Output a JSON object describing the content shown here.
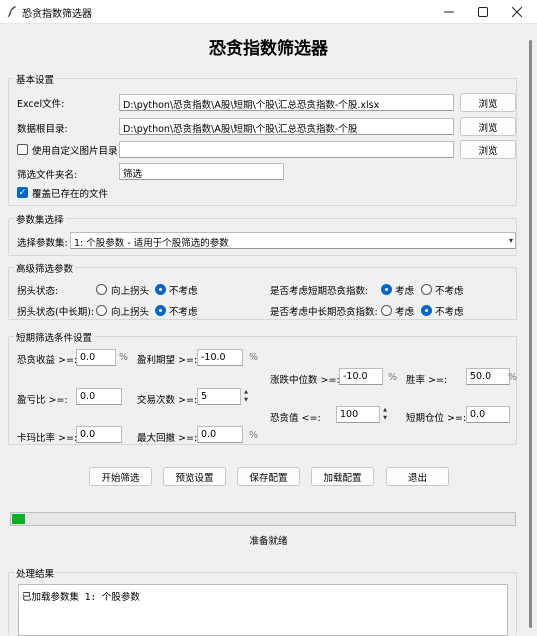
{
  "window": {
    "title": "恐贪指数筛选器",
    "minimize_icon": "minimize-icon",
    "maximize_icon": "maximize-icon",
    "close_icon": "close-icon"
  },
  "header": {
    "title": "恐贪指数筛选器"
  },
  "basic": {
    "title": "基本设置",
    "excel_label": "Excel文件:",
    "excel_value": "D:\\python\\恐贪指数\\A股\\短期\\个股\\汇总恐贪指数-个股.xlsx",
    "data_dir_label": "数据根目录:",
    "data_dir_value": "D:\\python\\恐贪指数\\A股\\短期\\个股\\汇总恐贪指数-个股",
    "custom_img_label": "使用自定义图片目录",
    "custom_img_checked": false,
    "custom_img_value": "",
    "browse_label": "浏览",
    "filter_folder_label": "筛选文件夹名:",
    "filter_folder_value": "筛选",
    "overwrite_label": "覆盖已存在的文件",
    "overwrite_checked": true
  },
  "param_set": {
    "title": "参数集选择",
    "select_label": "选择参数集:",
    "select_value": "1: 个股参数 - 适用于个股筛选的参数"
  },
  "advanced": {
    "title": "高级筛选参数",
    "tail_label": "拐头状态:",
    "tail_mid_label": "拐头状态(中长期):",
    "opt_up": "向上拐头",
    "opt_ignore": "不考虑",
    "short_fg_label": "是否考虑短期恐贪指数:",
    "mid_fg_label": "是否考虑中长期恐贪指数:",
    "opt_consider": "考虑",
    "opt_not_consider": "不考虑"
  },
  "short": {
    "title": "短期筛选条件设置",
    "fg_return_label": "恐贪收益 >=:",
    "fg_return_value": "0.0",
    "profit_exp_label": "盈利期望 >=:",
    "profit_exp_value": "-10.0",
    "median_label": "涨跌中位数 >=:",
    "median_value": "-10.0",
    "winrate_label": "胜率 >=:",
    "winrate_value": "50.0",
    "pl_ratio_label": "盈亏比 >=:",
    "pl_ratio_value": "0.0",
    "trades_label": "交易次数 >=:",
    "trades_value": "5",
    "fg_value_label": "恐贪值 <=:",
    "fg_value_value": "100",
    "short_pos_label": "短期仓位 >=:",
    "short_pos_value": "0.0",
    "calmar_label": "卡玛比率 >=:",
    "calmar_value": "0.0",
    "max_dd_label": "最大回撤 >=:",
    "max_dd_value": "0.0",
    "percent": "%"
  },
  "actions": {
    "start": "开始筛选",
    "preview": "预览设置",
    "save": "保存配置",
    "load": "加载配置",
    "exit": "退出"
  },
  "progress": {
    "value": 0.025,
    "color": "#06b025"
  },
  "status": "准备就绪",
  "result": {
    "title": "处理结果",
    "text": "已加载参数集 1: 个股参数"
  }
}
